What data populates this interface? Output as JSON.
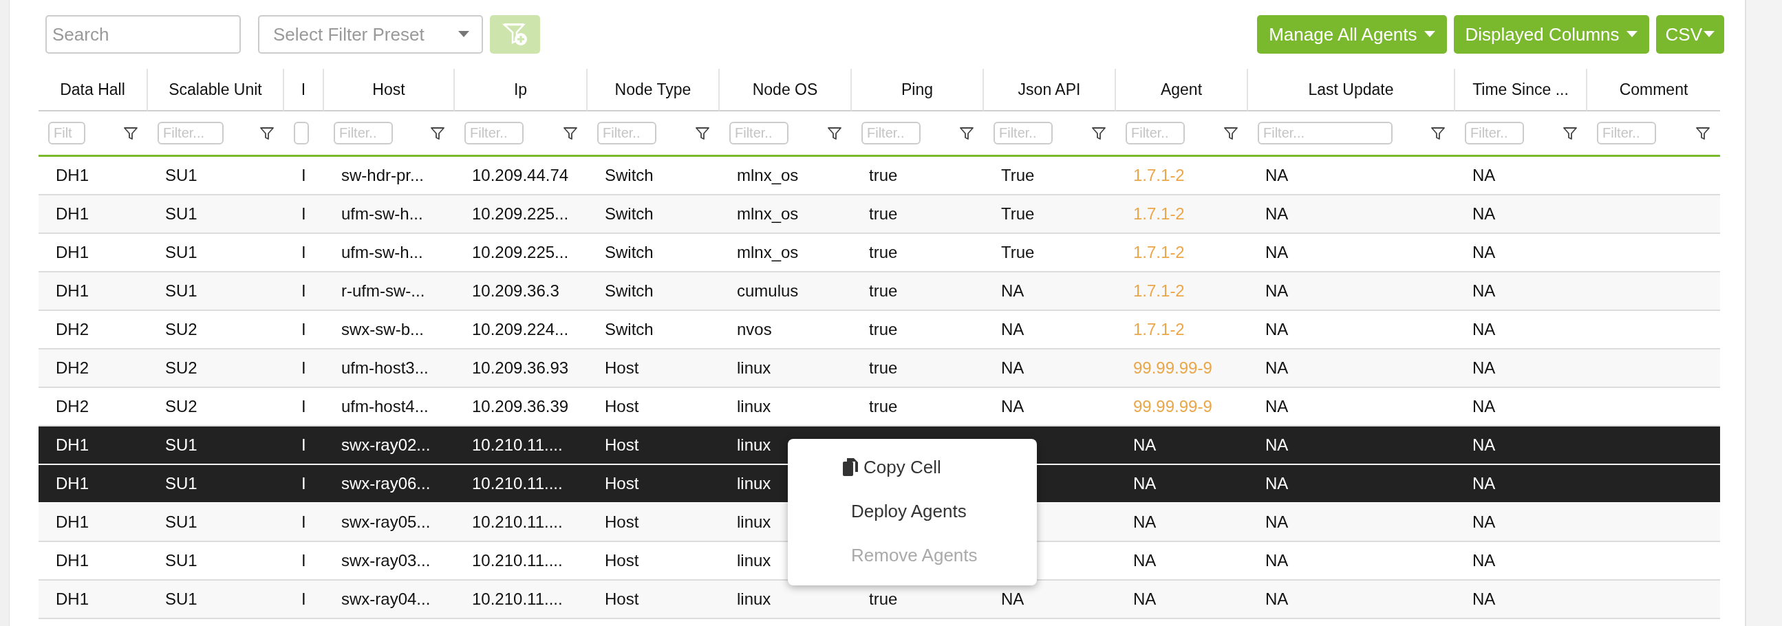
{
  "toolbar": {
    "search": {
      "placeholder": "Search"
    },
    "filter_preset": {
      "placeholder": "Select Filter Preset"
    },
    "add_filter_button": {
      "disabled": true
    },
    "buttons": [
      {
        "label": "Manage All Agents"
      },
      {
        "label": "Displayed Columns"
      },
      {
        "label": "CSV"
      }
    ]
  },
  "table": {
    "columns": [
      {
        "label": "Data Hall",
        "filter_placeholder": "Filt"
      },
      {
        "label": "Scalable Unit",
        "filter_placeholder": "Filter..."
      },
      {
        "label": "I"
      },
      {
        "label": "Host",
        "filter_placeholder": "Filter.."
      },
      {
        "label": "Ip",
        "filter_placeholder": "Filter.."
      },
      {
        "label": "Node Type",
        "filter_placeholder": "Filter.."
      },
      {
        "label": "Node OS",
        "filter_placeholder": "Filter.."
      },
      {
        "label": "Ping",
        "filter_placeholder": "Filter.."
      },
      {
        "label": "Json API",
        "filter_placeholder": "Filter.."
      },
      {
        "label": "Agent",
        "filter_placeholder": "Filter.."
      },
      {
        "label": "Last Update",
        "filter_placeholder": "Filter..."
      },
      {
        "label": "Time Since ...",
        "filter_placeholder": "Filter.."
      },
      {
        "label": "Comment",
        "filter_placeholder": "Filter.."
      }
    ],
    "rows": [
      {
        "selected": false,
        "data_hall": "DH1",
        "scalable_unit": "SU1",
        "column_3": "I",
        "host": "sw-hdr-pr...",
        "ip": "10.209.44.74",
        "node_type": "Switch",
        "node_os": "mlnx_os",
        "ping": "true",
        "json_api": "True",
        "agent": {
          "text": "1.7.1-2",
          "kind": "version"
        },
        "last_update": "NA",
        "time_since": "NA"
      },
      {
        "selected": false,
        "data_hall": "DH1",
        "scalable_unit": "SU1",
        "column_3": "I",
        "host": "ufm-sw-h...",
        "ip": "10.209.225...",
        "node_type": "Switch",
        "node_os": "mlnx_os",
        "ping": "true",
        "json_api": "True",
        "agent": {
          "text": "1.7.1-2",
          "kind": "version"
        },
        "last_update": "NA",
        "time_since": "NA"
      },
      {
        "selected": false,
        "data_hall": "DH1",
        "scalable_unit": "SU1",
        "column_3": "I",
        "host": "ufm-sw-h...",
        "ip": "10.209.225...",
        "node_type": "Switch",
        "node_os": "mlnx_os",
        "ping": "true",
        "json_api": "True",
        "agent": {
          "text": "1.7.1-2",
          "kind": "version"
        },
        "last_update": "NA",
        "time_since": "NA"
      },
      {
        "selected": false,
        "data_hall": "DH1",
        "scalable_unit": "SU1",
        "column_3": "I",
        "host": "r-ufm-sw-...",
        "ip": "10.209.36.3",
        "node_type": "Switch",
        "node_os": "cumulus",
        "ping": "true",
        "json_api": "NA",
        "agent": {
          "text": "1.7.1-2",
          "kind": "version"
        },
        "last_update": "NA",
        "time_since": "NA"
      },
      {
        "selected": false,
        "data_hall": "DH2",
        "scalable_unit": "SU2",
        "column_3": "I",
        "host": "swx-sw-b...",
        "ip": "10.209.224...",
        "node_type": "Switch",
        "node_os": "nvos",
        "ping": "true",
        "json_api": "NA",
        "agent": {
          "text": "1.7.1-2",
          "kind": "version"
        },
        "last_update": "NA",
        "time_since": "NA"
      },
      {
        "selected": false,
        "data_hall": "DH2",
        "scalable_unit": "SU2",
        "column_3": "I",
        "host": "ufm-host3...",
        "ip": "10.209.36.93",
        "node_type": "Host",
        "node_os": "linux",
        "ping": "true",
        "json_api": "NA",
        "agent": {
          "text": "99.99.99-9",
          "kind": "version"
        },
        "last_update": "NA",
        "time_since": "NA"
      },
      {
        "selected": false,
        "data_hall": "DH2",
        "scalable_unit": "SU2",
        "column_3": "I",
        "host": "ufm-host4...",
        "ip": "10.209.36.39",
        "node_type": "Host",
        "node_os": "linux",
        "ping": "true",
        "json_api": "NA",
        "agent": {
          "text": "99.99.99-9",
          "kind": "version"
        },
        "last_update": "NA",
        "time_since": "NA"
      },
      {
        "selected": true,
        "data_hall": "DH1",
        "scalable_unit": "SU1",
        "column_3": "I",
        "host": "swx-ray02...",
        "ip": "10.210.11....",
        "node_type": "Host",
        "node_os": "linux",
        "agent": "NA",
        "last_update": "NA",
        "time_since": "NA"
      },
      {
        "selected": true,
        "data_hall": "DH1",
        "scalable_unit": "SU1",
        "column_3": "I",
        "host": "swx-ray06...",
        "ip": "10.210.11....",
        "node_type": "Host",
        "node_os": "linux",
        "agent": "NA",
        "last_update": "NA",
        "time_since": "NA"
      },
      {
        "selected": false,
        "data_hall": "DH1",
        "scalable_unit": "SU1",
        "column_3": "I",
        "host": "swx-ray05...",
        "ip": "10.210.11....",
        "node_type": "Host",
        "node_os": "linux",
        "agent": "NA",
        "last_update": "NA",
        "time_since": "NA"
      },
      {
        "selected": false,
        "data_hall": "DH1",
        "scalable_unit": "SU1",
        "column_3": "I",
        "host": "swx-ray03...",
        "ip": "10.210.11....",
        "node_type": "Host",
        "node_os": "linux",
        "agent": "NA",
        "last_update": "NA",
        "time_since": "NA"
      },
      {
        "selected": false,
        "data_hall": "DH1",
        "scalable_unit": "SU1",
        "column_3": "I",
        "host": "swx-ray04...",
        "ip": "10.210.11....",
        "node_type": "Host",
        "node_os": "linux",
        "ping": "true",
        "json_api": "NA",
        "agent": "NA",
        "last_update": "NA",
        "time_since": "NA"
      }
    ]
  },
  "context_menu": {
    "items": [
      {
        "label": "Copy Cell",
        "kind": "copy",
        "disabled": false
      },
      {
        "label": "Deploy Agents",
        "kind": "plain",
        "disabled": false
      },
      {
        "label": "Remove Agents",
        "kind": "plain",
        "disabled": true
      }
    ]
  }
}
